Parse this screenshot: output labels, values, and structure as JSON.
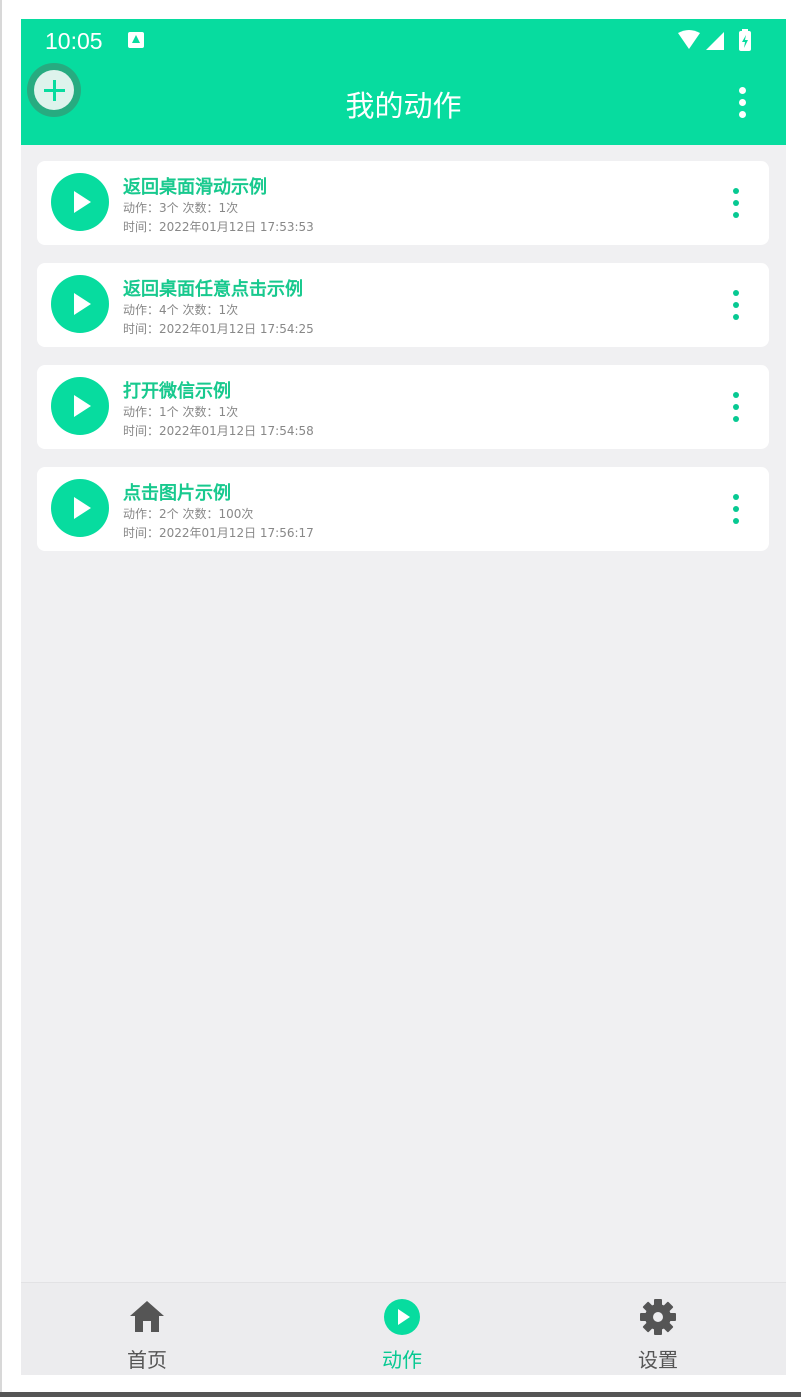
{
  "status_bar": {
    "time": "10:05"
  },
  "header": {
    "title": "我的动作"
  },
  "actions": [
    {
      "name": "返回桌面滑动示例",
      "stats": "动作：3个 次数：1次",
      "time": "时间：2022年01月12日 17:53:53"
    },
    {
      "name": "返回桌面任意点击示例",
      "stats": "动作：4个 次数：1次",
      "time": "时间：2022年01月12日 17:54:25"
    },
    {
      "name": "打开微信示例",
      "stats": "动作：1个 次数：1次",
      "time": "时间：2022年01月12日 17:54:58"
    },
    {
      "name": "点击图片示例",
      "stats": "动作：2个 次数：100次",
      "time": "时间：2022年01月12日 17:56:17"
    }
  ],
  "nav": {
    "home": "首页",
    "actions": "动作",
    "settings": "设置"
  },
  "colors": {
    "accent": "#07dc9f",
    "background": "#f0f0f2",
    "inactive": "#555555"
  }
}
